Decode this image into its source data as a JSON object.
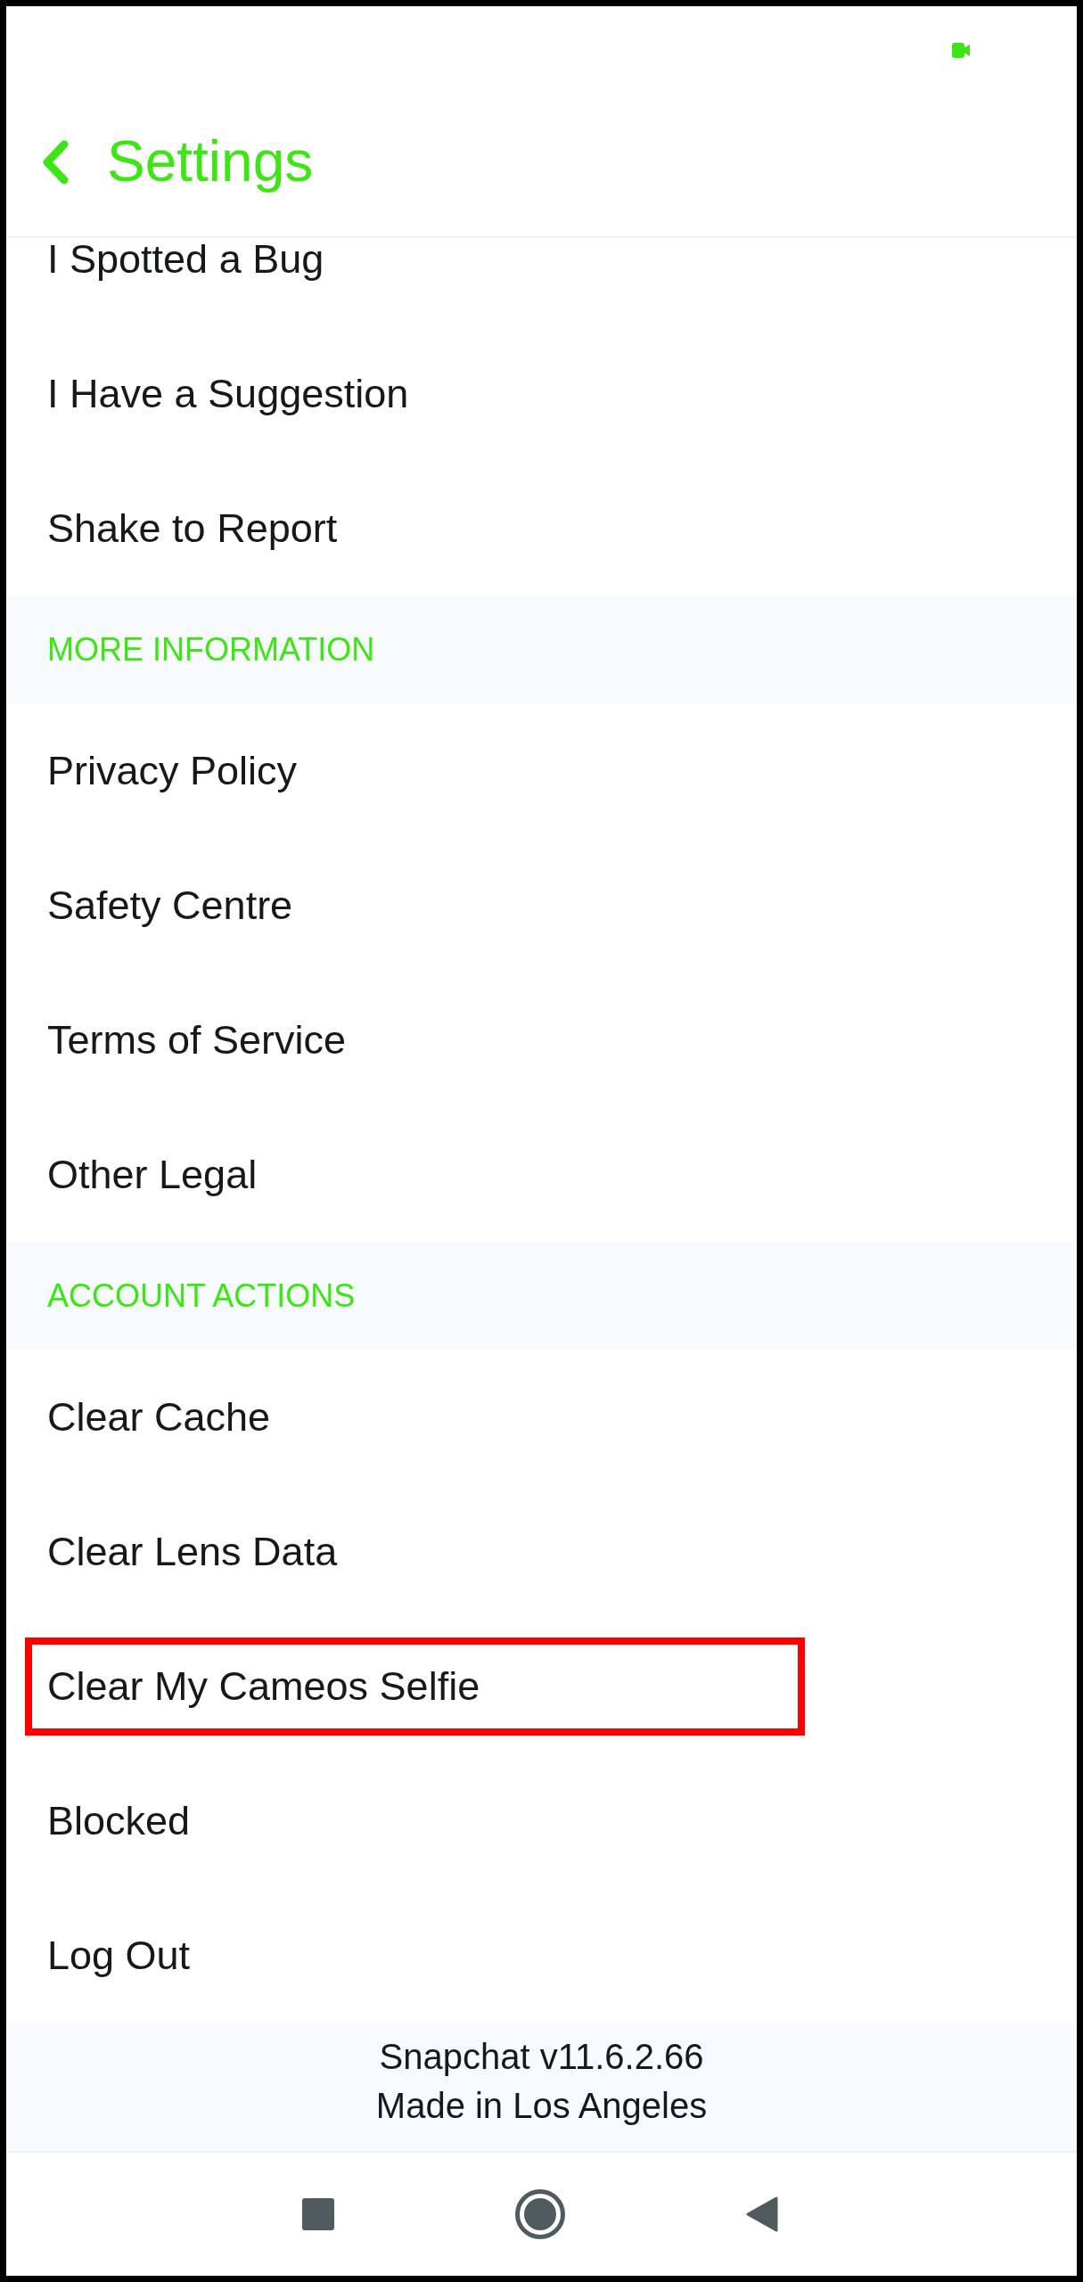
{
  "header": {
    "title": "Settings"
  },
  "list": [
    {
      "kind": "item",
      "label": "I Spotted a Bug",
      "highlighted": false
    },
    {
      "kind": "item",
      "label": "I Have a Suggestion",
      "highlighted": false
    },
    {
      "kind": "item",
      "label": "Shake to Report",
      "highlighted": false
    },
    {
      "kind": "section",
      "label": "MORE INFORMATION"
    },
    {
      "kind": "item",
      "label": "Privacy Policy",
      "highlighted": false
    },
    {
      "kind": "item",
      "label": "Safety Centre",
      "highlighted": false
    },
    {
      "kind": "item",
      "label": "Terms of Service",
      "highlighted": false
    },
    {
      "kind": "item",
      "label": "Other Legal",
      "highlighted": false
    },
    {
      "kind": "section",
      "label": "ACCOUNT ACTIONS"
    },
    {
      "kind": "item",
      "label": "Clear Cache",
      "highlighted": false
    },
    {
      "kind": "item",
      "label": "Clear Lens Data",
      "highlighted": false
    },
    {
      "kind": "item",
      "label": "Clear My Cameos Selfie",
      "highlighted": true
    },
    {
      "kind": "item",
      "label": "Blocked",
      "highlighted": false
    },
    {
      "kind": "item",
      "label": "Log Out",
      "highlighted": false
    }
  ],
  "footer": {
    "lines": [
      "Snapchat v11.6.2.66",
      "Made in Los Angeles"
    ]
  }
}
